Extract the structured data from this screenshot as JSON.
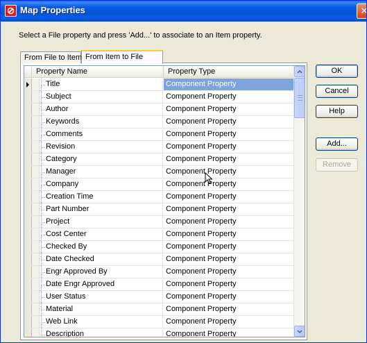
{
  "window": {
    "title": "Map Properties",
    "close_glyph": "✕",
    "app_icon": "app-logo-icon"
  },
  "instruction": "Select a File property and press 'Add...' to associate to an Item property.",
  "tabs": [
    {
      "label": "From File to Item",
      "active": false
    },
    {
      "label": "From Item to File",
      "active": true
    }
  ],
  "grid": {
    "columns": [
      "Property Name",
      "Property Type"
    ],
    "rows": [
      {
        "name": "Title",
        "type": "Component Property",
        "selected": true
      },
      {
        "name": "Subject",
        "type": "Component Property"
      },
      {
        "name": "Author",
        "type": "Component Property"
      },
      {
        "name": "Keywords",
        "type": "Component Property"
      },
      {
        "name": "Comments",
        "type": "Component Property"
      },
      {
        "name": "Revision",
        "type": "Component Property"
      },
      {
        "name": "Category",
        "type": "Component Property"
      },
      {
        "name": "Manager",
        "type": "Component Property"
      },
      {
        "name": "Company",
        "type": "Component Property"
      },
      {
        "name": "Creation Time",
        "type": "Component Property"
      },
      {
        "name": "Part Number",
        "type": "Component Property"
      },
      {
        "name": "Project",
        "type": "Component Property"
      },
      {
        "name": "Cost Center",
        "type": "Component Property"
      },
      {
        "name": "Checked By",
        "type": "Component Property"
      },
      {
        "name": "Date Checked",
        "type": "Component Property"
      },
      {
        "name": "Engr Approved By",
        "type": "Component Property"
      },
      {
        "name": "Date Engr Approved",
        "type": "Component Property"
      },
      {
        "name": "User Status",
        "type": "Component Property"
      },
      {
        "name": "Material",
        "type": "Component Property"
      },
      {
        "name": "Web Link",
        "type": "Component Property"
      },
      {
        "name": "Description",
        "type": "Component Property"
      }
    ]
  },
  "buttons": {
    "ok": "OK",
    "cancel": "Cancel",
    "help": "Help",
    "add": "Add...",
    "remove": "Remove"
  },
  "colors": {
    "titlebar": "#0a5ae3",
    "selection": "#7fa3dc",
    "tab_highlight": "#ffc83c"
  }
}
